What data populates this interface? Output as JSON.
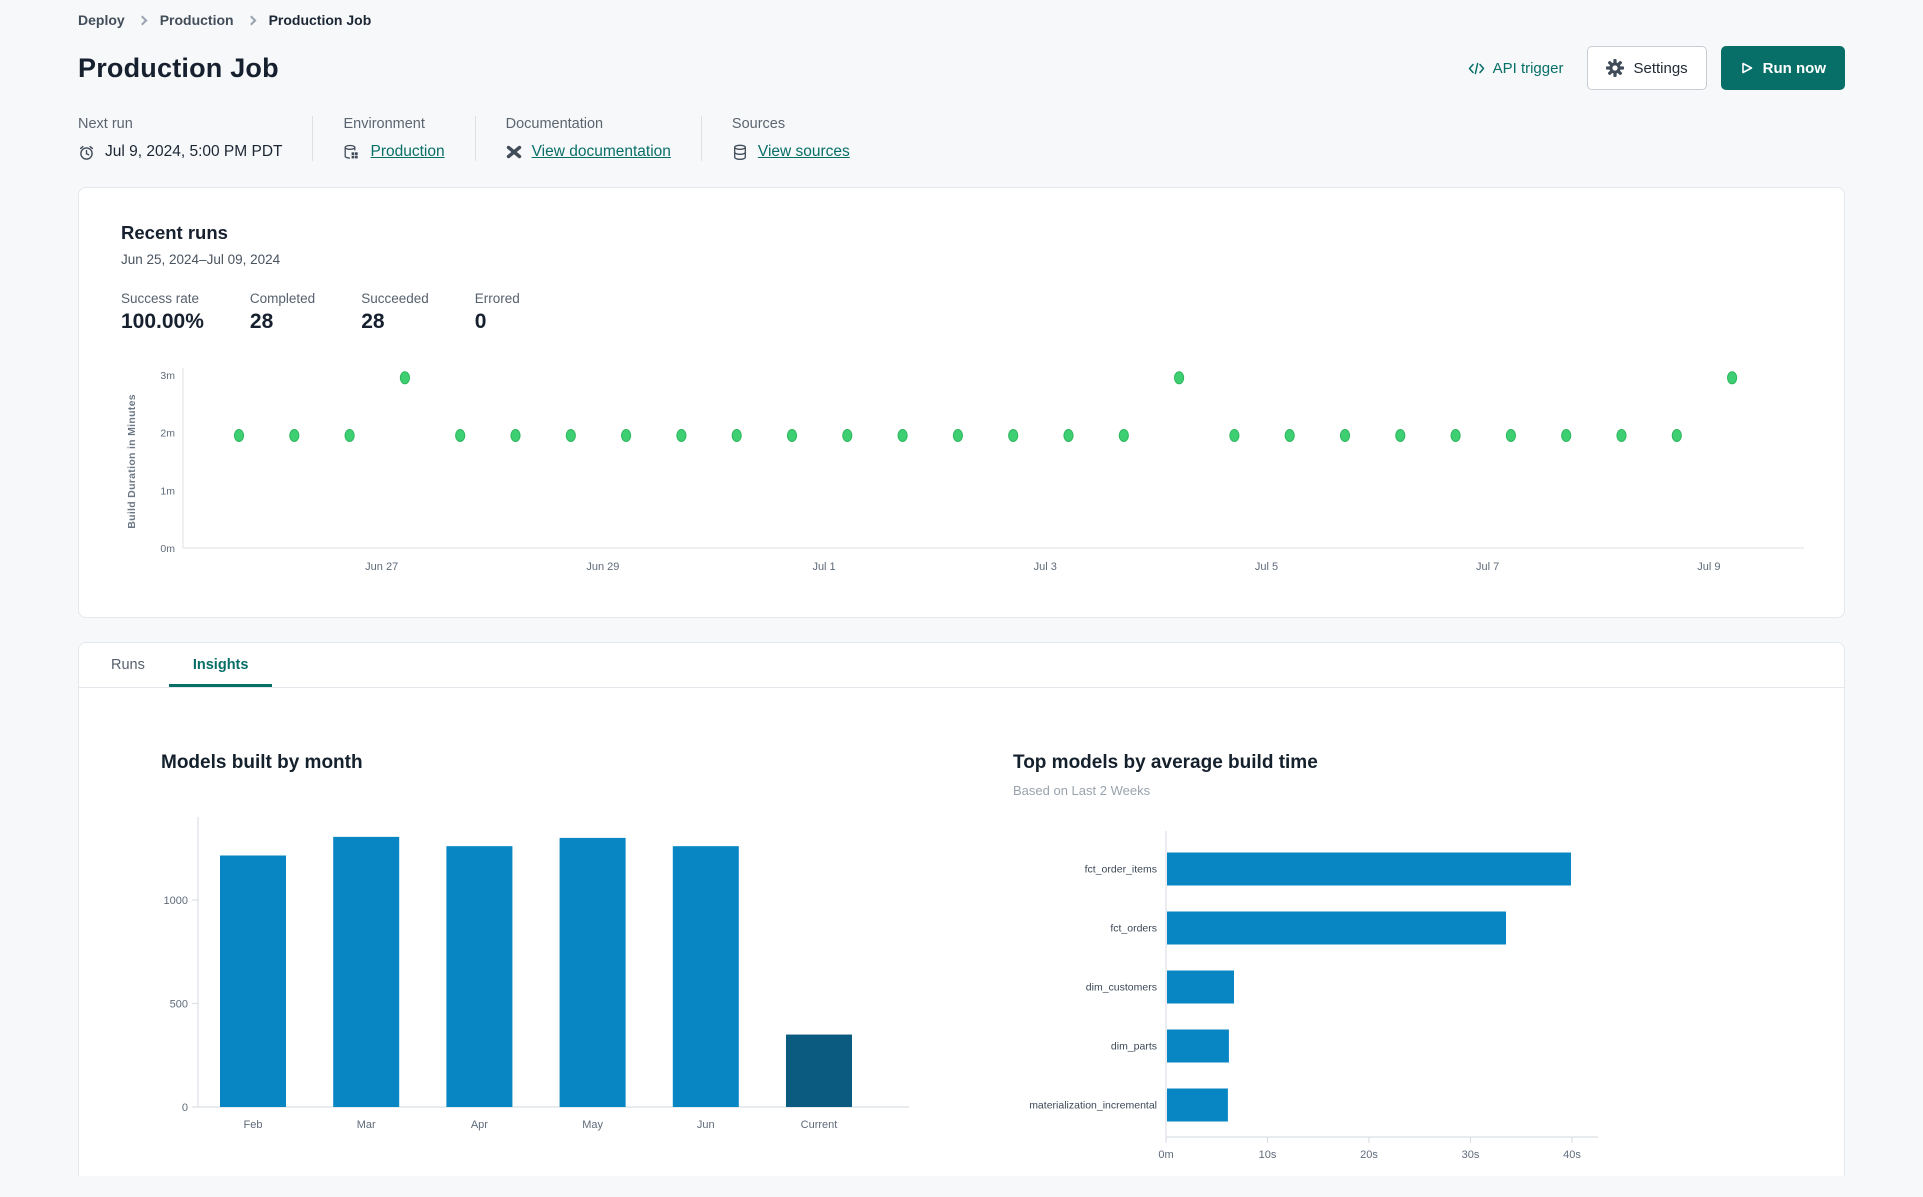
{
  "breadcrumb": {
    "items": [
      "Deploy",
      "Production",
      "Production Job"
    ]
  },
  "header": {
    "title": "Production Job",
    "api_trigger_label": "API trigger",
    "settings_label": "Settings",
    "run_now_label": "Run now"
  },
  "meta": {
    "next_run_label": "Next run",
    "next_run_value": "Jul 9, 2024, 5:00 PM PDT",
    "environment_label": "Environment",
    "environment_value": "Production",
    "documentation_label": "Documentation",
    "documentation_value": "View documentation",
    "sources_label": "Sources",
    "sources_value": "View sources"
  },
  "recent_runs": {
    "title": "Recent runs",
    "date_range": "Jun 25, 2024–Jul 09, 2024",
    "stats": [
      {
        "label": "Success rate",
        "value": "100.00%"
      },
      {
        "label": "Completed",
        "value": "28"
      },
      {
        "label": "Succeeded",
        "value": "28"
      },
      {
        "label": "Errored",
        "value": "0"
      }
    ]
  },
  "tabs": [
    {
      "label": "Runs",
      "active": false
    },
    {
      "label": "Insights",
      "active": true
    }
  ],
  "insights": {
    "models_by_month_title": "Models built by month",
    "top_models_title": "Top models by average build time",
    "top_models_subtitle": "Based on Last 2 Weeks"
  },
  "icons": [
    "alarm-clock-icon",
    "environment-icon",
    "dbt-docs-icon",
    "database-icon",
    "code-icon",
    "gear-icon",
    "play-icon",
    "chevron-right-icon"
  ],
  "colors": {
    "teal": "#086f68",
    "dot_green": "#3ecf72",
    "dot_green_stroke": "#2db65e",
    "bar_blue": "#0786c3",
    "bar_dark": "#0b5a7f",
    "axis_text": "#5f6b7a",
    "axis_line": "#dce0e5",
    "label_text": "#3c4857"
  },
  "chart_data": [
    {
      "id": "build-duration-scatter",
      "type": "scatter",
      "ylabel": "Build Duration in Minutes",
      "yticks": [
        {
          "v": 0,
          "label": "0m"
        },
        {
          "v": 1,
          "label": "1m"
        },
        {
          "v": 2,
          "label": "2m"
        },
        {
          "v": 3,
          "label": "3m"
        }
      ],
      "ylim": [
        0,
        3.2
      ],
      "points_minutes": [
        1.95,
        1.95,
        1.95,
        2.95,
        1.95,
        1.95,
        1.95,
        1.95,
        1.95,
        1.95,
        1.95,
        1.95,
        1.95,
        1.95,
        1.95,
        1.95,
        1.95,
        2.95,
        1.95,
        1.95,
        1.95,
        1.95,
        1.95,
        1.95,
        1.95,
        1.95,
        1.95,
        2.95
      ],
      "xticks": [
        {
          "index": 2.58,
          "label": "Jun 27"
        },
        {
          "index": 6.58,
          "label": "Jun 29"
        },
        {
          "index": 10.58,
          "label": "Jul 1"
        },
        {
          "index": 14.58,
          "label": "Jul 3"
        },
        {
          "index": 18.58,
          "label": "Jul 5"
        },
        {
          "index": 22.58,
          "label": "Jul 7"
        },
        {
          "index": 26.58,
          "label": "Jul 9"
        }
      ]
    },
    {
      "id": "models-built-by-month",
      "type": "bar",
      "title": "Models built by month",
      "categories": [
        "Feb",
        "Mar",
        "Apr",
        "May",
        "Jun",
        "Current"
      ],
      "values": [
        1215,
        1305,
        1260,
        1300,
        1260,
        350
      ],
      "yticks": [
        0,
        500,
        1000
      ],
      "ylim": [
        0,
        1400
      ],
      "highlight_last_bar": true
    },
    {
      "id": "top-models-by-build-time",
      "type": "horizontal-bar",
      "title": "Top models by average build time",
      "subtitle": "Based on Last 2 Weeks",
      "categories": [
        "fct_order_items",
        "fct_orders",
        "dim_customers",
        "dim_parts",
        "materialization_incremental"
      ],
      "values_seconds": [
        39.8,
        33.4,
        6.6,
        6.1,
        6.0
      ],
      "xticks": [
        {
          "v": 0,
          "label": "0m"
        },
        {
          "v": 10,
          "label": "10s"
        },
        {
          "v": 20,
          "label": "20s"
        },
        {
          "v": 30,
          "label": "30s"
        },
        {
          "v": 40,
          "label": "40s"
        }
      ],
      "xlim": [
        0,
        44
      ]
    }
  ]
}
